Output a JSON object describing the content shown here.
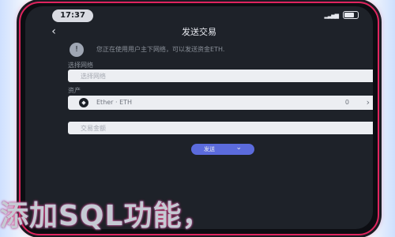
{
  "status": {
    "time": "17:37",
    "signal": "▂▃▅▆"
  },
  "header": {
    "title": "发送交易",
    "back": "‹"
  },
  "notice": {
    "icon": "!",
    "text": "您正在使用用户主下网络，可以发送资金ETH."
  },
  "fields": {
    "network": {
      "label": "选择网络",
      "placeholder": "选择网络"
    },
    "asset": {
      "label": "资产",
      "name": "Ether · ETH",
      "balance": "0",
      "icon": "eth-icon"
    },
    "amount": {
      "placeholder": "交易金额"
    }
  },
  "send_button": {
    "label": "发送",
    "arrow": "⌄"
  },
  "banner": {
    "text": "添加SQL功能，"
  }
}
